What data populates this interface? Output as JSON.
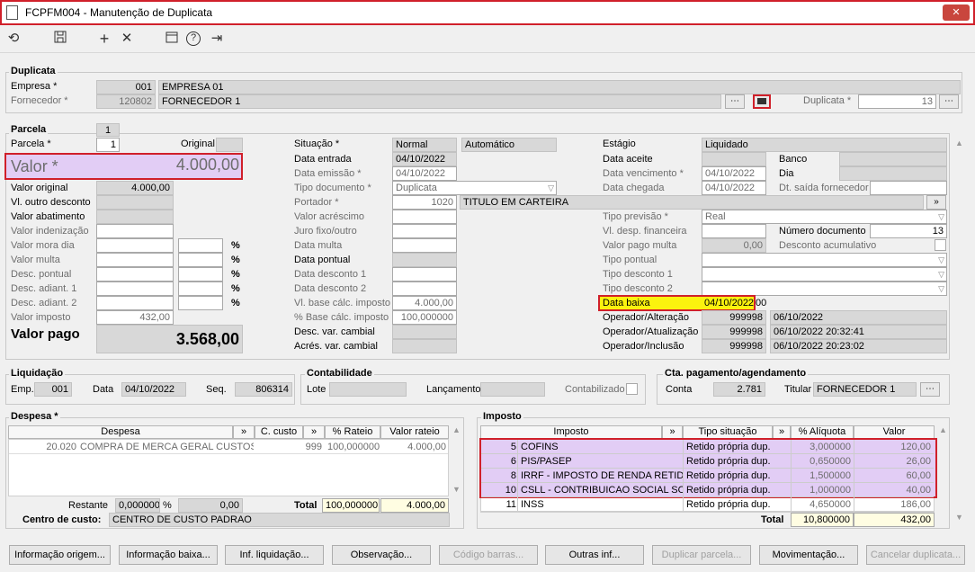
{
  "window": {
    "title": "FCPFM004 - Manutenção de Duplicata",
    "close": "✕"
  },
  "toolbar": {
    "refresh": "⟲",
    "save": "💾",
    "add": "+",
    "remove": "✕",
    "calendar": "📅",
    "help": "?",
    "exit": "⇥"
  },
  "duplicata": {
    "title": "Duplicata",
    "empresa_label": "Empresa *",
    "empresa_code": "001",
    "empresa_name": "EMPRESA 01",
    "fornecedor_label": "Fornecedor *",
    "fornecedor_code": "120802",
    "fornecedor_name": "FORNECEDOR 1",
    "duplicata_label": "Duplicata *",
    "duplicata_value": "13"
  },
  "parcela": {
    "tab": "Parcela",
    "tab_num": "1",
    "parcela_label": "Parcela *",
    "parcela_value": "1",
    "original_label": "Original",
    "valor_label": "Valor *",
    "valor_value": "4.000,00",
    "valor_original_label": "Valor original",
    "valor_original": "4.000,00",
    "vl_outro_desconto_label": "Vl. outro desconto",
    "valor_abatimento_label": "Valor abatimento",
    "valor_indenizacao_label": "Valor indenização",
    "valor_mora_dia_label": "Valor mora dia",
    "valor_multa_label": "Valor multa",
    "desc_pontual_label": "Desc. pontual",
    "desc_adiant1_label": "Desc. adiant. 1",
    "desc_adiant2_label": "Desc. adiant. 2",
    "valor_imposto_label": "Valor imposto",
    "valor_imposto": "432,00",
    "valor_pago_label": "Valor pago",
    "valor_pago": "3.568,00",
    "pct": "%"
  },
  "mid": {
    "situacao_label": "Situação *",
    "situacao": "Normal",
    "automatico": "Automático",
    "data_entrada_label": "Data entrada",
    "data_entrada": "04/10/2022",
    "data_emissao_label": "Data emissão *",
    "data_emissao": "04/10/2022",
    "tipo_documento_label": "Tipo documento *",
    "tipo_documento": "Duplicata",
    "portador_label": "Portador *",
    "portador_code": "1020",
    "portador_name": "TITULO EM CARTEIRA",
    "valor_acrescimo_label": "Valor acréscimo",
    "juro_label": "Juro fixo/outro",
    "data_multa_label": "Data multa",
    "data_pontual_label": "Data pontual",
    "data_desc1_label": "Data desconto 1",
    "data_desc2_label": "Data desconto 2",
    "vl_base_label": "Vl. base cálc. imposto",
    "vl_base": "4.000,00",
    "pct_base_label": "% Base cálc. imposto",
    "pct_base": "100,000000",
    "desc_var_label": "Desc. var. cambial",
    "acres_var_label": "Acrés. var. cambial"
  },
  "right": {
    "estagio_label": "Estágio",
    "estagio": "Liquidado",
    "data_aceite_label": "Data aceite",
    "banco_label": "Banco",
    "data_venc_label": "Data vencimento *",
    "data_venc": "04/10/2022",
    "dia_label": "Dia",
    "data_chegada_label": "Data chegada",
    "data_chegada": "04/10/2022",
    "dt_saida_label": "Dt. saída fornecedor",
    "tipo_previsao_label": "Tipo previsão *",
    "tipo_previsao": "Real",
    "vl_desp_label": "Vl. desp. financeira",
    "numero_doc_label": "Número documento",
    "numero_doc": "13",
    "valor_pago_multa_label": "Valor pago multa",
    "valor_pago_multa": "0,00",
    "desconto_acum_label": "Desconto acumulativo",
    "tipo_pontual_label": "Tipo pontual",
    "tipo_desc1_label": "Tipo desconto 1",
    "tipo_desc2_label": "Tipo desconto 2",
    "data_baixa_label": "Data baixa",
    "data_baixa": "04/10/2022",
    "data_baixa_suffix": "00",
    "op_alt_label": "Operador/Alteração",
    "op_alt_code": "999998",
    "op_alt_date": "06/10/2022",
    "op_atu_label": "Operador/Atualização",
    "op_atu_code": "999998",
    "op_atu_date": "06/10/2022 20:32:41",
    "op_inc_label": "Operador/Inclusão",
    "op_inc_code": "999998",
    "op_inc_date": "06/10/2022 20:23:02"
  },
  "liquidacao": {
    "title": "Liquidação",
    "emp_label": "Emp.",
    "emp": "001",
    "data_label": "Data",
    "data": "04/10/2022",
    "seq_label": "Seq.",
    "seq": "806314"
  },
  "contabilidade": {
    "title": "Contabilidade",
    "lote_label": "Lote",
    "lancamento_label": "Lançamento",
    "contabilizado_label": "Contabilizado"
  },
  "cta": {
    "title": "Cta. pagamento/agendamento",
    "conta_label": "Conta",
    "conta": "2.781",
    "titular_label": "Titular",
    "titular": "FORNECEDOR 1"
  },
  "despesa": {
    "title": "Despesa *",
    "col_despesa": "Despesa",
    "col_ccusto": "C. custo",
    "col_rateio": "% Rateio",
    "col_valor": "Valor rateio",
    "chev": "»",
    "rows": [
      {
        "code": "20.020",
        "name": "COMPRA DE MERCA GERAL CUSTOS M",
        "ccusto": "999",
        "rateio": "100,000000",
        "valor": "4.000,00"
      }
    ],
    "restante_label": "Restante",
    "restante_pct": "0,000000",
    "restante_val": "0,00",
    "pct": "%",
    "total_label": "Total",
    "total_pct": "100,000000",
    "total_val": "4.000,00",
    "centro_label": "Centro de custo:",
    "centro": "CENTRO DE CUSTO PADRAO"
  },
  "imposto": {
    "title": "Imposto",
    "col_imposto": "Imposto",
    "col_tipo": "Tipo situação",
    "col_aliq": "% Alíquota",
    "col_valor": "Valor",
    "chev": "»",
    "rows": [
      {
        "code": "5",
        "name": "COFINS",
        "tipo": "Retido própria dup.",
        "aliq": "3,000000",
        "valor": "120,00"
      },
      {
        "code": "6",
        "name": "PIS/PASEP",
        "tipo": "Retido própria dup.",
        "aliq": "0,650000",
        "valor": "26,00"
      },
      {
        "code": "8",
        "name": "IRRF - IMPOSTO DE RENDA RETIDO N",
        "tipo": "Retido própria dup.",
        "aliq": "1,500000",
        "valor": "60,00"
      },
      {
        "code": "10",
        "name": "CSLL - CONTRIBUICAO SOCIAL SOB",
        "tipo": "Retido própria dup.",
        "aliq": "1,000000",
        "valor": "40,00"
      },
      {
        "code": "11",
        "name": "INSS",
        "tipo": "Retido própria dup.",
        "aliq": "4,650000",
        "valor": "186,00"
      }
    ],
    "total_label": "Total",
    "total_aliq": "10,800000",
    "total_val": "432,00"
  },
  "buttons": [
    "Informação origem...",
    "Informação baixa...",
    "Inf. liquidação...",
    "Observação...",
    "Código barras...",
    "Outras inf...",
    "Duplicar parcela...",
    "Movimentação...",
    "Cancelar duplicata..."
  ]
}
